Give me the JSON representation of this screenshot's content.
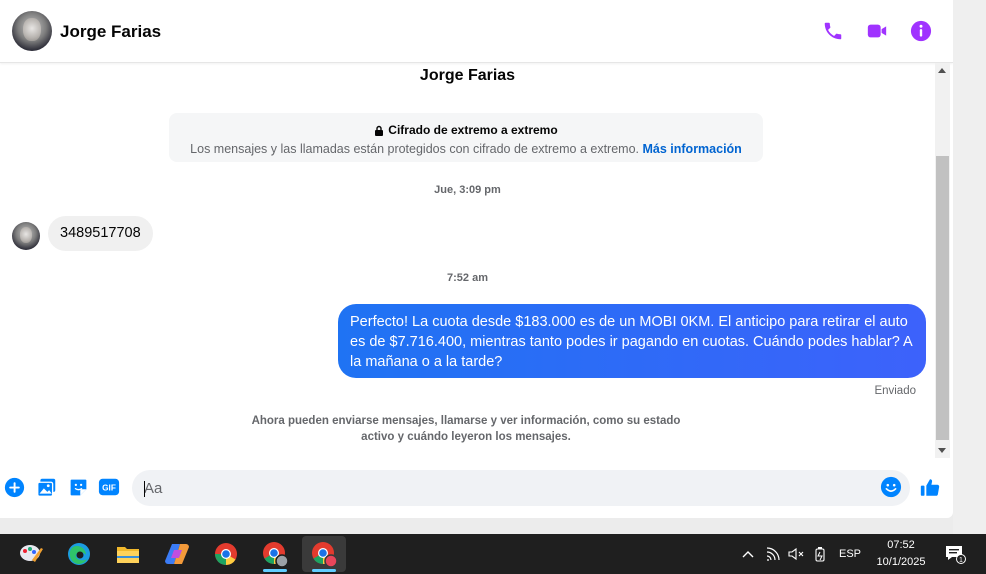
{
  "header": {
    "contact_name": "Jorge Farias",
    "icons": [
      "phone-icon",
      "video-camera-icon",
      "info-icon"
    ]
  },
  "conversation": {
    "profile_name": "Jorge Farias",
    "encryption": {
      "title": "Cifrado de extremo a extremo",
      "description": "Los mensajes y las llamadas están protegidos con cifrado de extremo a extremo.",
      "link": "Más información"
    },
    "timestamps": [
      "Jue, 3:09 pm",
      "7:52 am"
    ],
    "messages": [
      {
        "direction": "incoming",
        "text": "3489517708"
      },
      {
        "direction": "outgoing",
        "text": "Perfecto! La cuota desde $183.000 es de un MOBI 0KM. El anticipo para retirar el auto es de $7.716.400, mientras tanto podes ir pagando en cuotas. Cuándo podes hablar? A la mañana o a la tarde?"
      }
    ],
    "sent_status": "Enviado",
    "info_note": "Ahora pueden enviarse mensajes, llamarse y ver información, como su estado activo y cuándo leyeron los mensajes."
  },
  "composer": {
    "placeholder": "Aa",
    "gif_label": "GIF"
  },
  "taskbar": {
    "language": "ESP",
    "time": "07:52",
    "date": "10/1/2025",
    "notification_count": "1"
  },
  "colors": {
    "accent_purple": "#a033ff",
    "messenger_blue": "#0084ff",
    "outgoing_bubble": "#2f6bf7",
    "incoming_bubble": "#f0f0f0"
  }
}
